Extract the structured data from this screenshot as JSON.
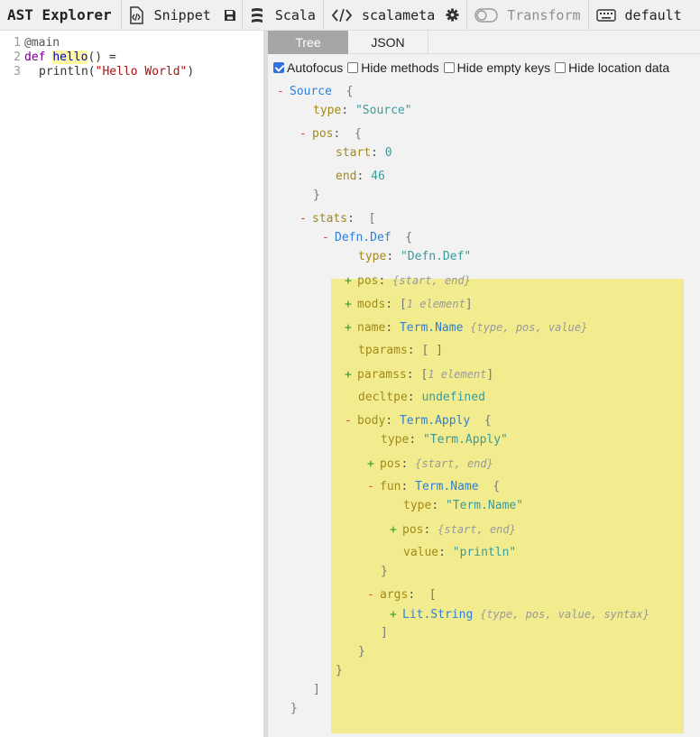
{
  "toolbar": {
    "title": "AST Explorer",
    "snippet_label": "Snippet",
    "language_label": "Scala",
    "parser_label": "scalameta",
    "transform_label": "Transform",
    "keymap_label": "default"
  },
  "editor": {
    "lines": [
      {
        "num": "1",
        "anno": "@main"
      },
      {
        "num": "2",
        "kw": "def ",
        "name": "hello",
        "rest": "() ="
      },
      {
        "num": "3",
        "call": "println(",
        "str": "\"Hello World\"",
        "close": ")"
      }
    ]
  },
  "output": {
    "tabs": [
      "Tree",
      "JSON"
    ],
    "options": [
      {
        "label": "Autofocus",
        "checked": true
      },
      {
        "label": "Hide methods",
        "checked": false
      },
      {
        "label": "Hide empty keys",
        "checked": false
      },
      {
        "label": "Hide location data",
        "checked": false
      }
    ]
  },
  "tree": {
    "source_name": "Source",
    "source_type": "\"Source\"",
    "pos_start": "0",
    "pos_end": "46",
    "defn_name": "Defn.Def",
    "defn_type": "\"Defn.Def\"",
    "pos_summary": "{start, end}",
    "mods_summary": "1 element",
    "name_type": "Term.Name",
    "name_summary": "{type, pos, value}",
    "tparams_value": "[ ]",
    "paramss_summary": "1 element",
    "decltpe_value": "undefined",
    "body_type": "Term.Apply",
    "body_type_str": "\"Term.Apply\"",
    "fun_type": "Term.Name",
    "fun_type_str": "\"Term.Name\"",
    "fun_value": "\"println\"",
    "arg_type": "Lit.String",
    "arg_summary": "{type, pos, value, syntax}",
    "keys": {
      "type": "type",
      "pos": "pos",
      "start": "start",
      "end": "end",
      "stats": "stats",
      "mods": "mods",
      "name": "name",
      "tparams": "tparams",
      "paramss": "paramss",
      "decltpe": "decltpe",
      "body": "body",
      "fun": "fun",
      "value": "value",
      "args": "args"
    }
  },
  "colors": {
    "highlight": "#f2ec8f",
    "key": "#a08a1a",
    "type_name": "#2f7fd6",
    "string_value": "#3b9b9b",
    "collapse_toggle": "#e04040",
    "expand_toggle": "#2e9a2e"
  }
}
